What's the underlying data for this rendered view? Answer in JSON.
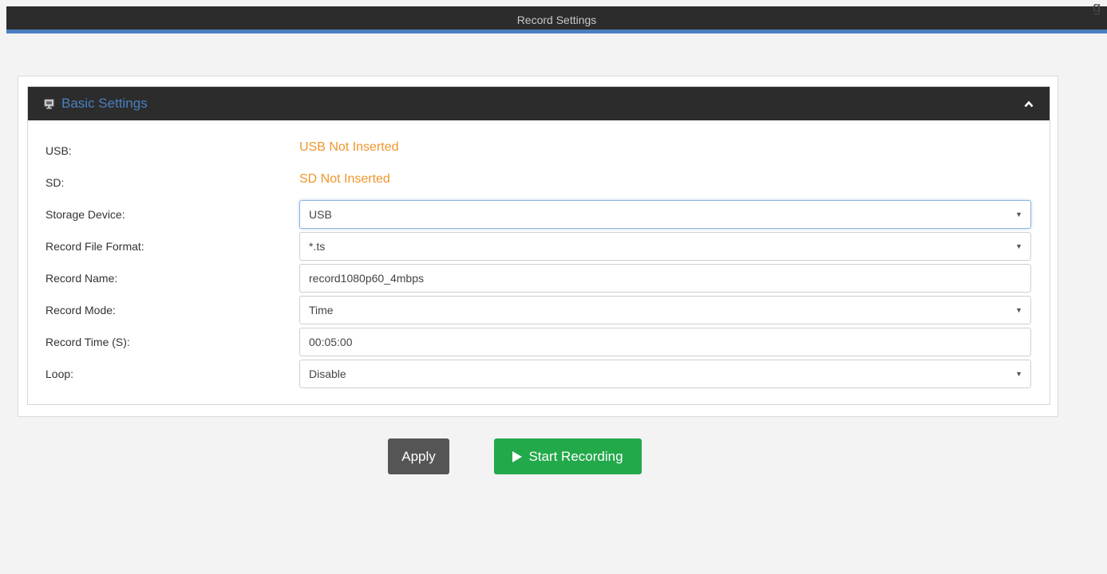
{
  "header": {
    "title": "Record Settings",
    "corner_glyph": "g"
  },
  "panel": {
    "title": "Basic Settings",
    "icon": "monitor-icon",
    "collapse_icon": "chevron-up-icon"
  },
  "status": {
    "usb": {
      "label": "USB:",
      "value": "USB Not Inserted"
    },
    "sd": {
      "label": "SD:",
      "value": "SD Not Inserted"
    }
  },
  "fields": {
    "storage_device": {
      "label": "Storage Device:",
      "value": "USB"
    },
    "record_file_format": {
      "label": "Record File Format:",
      "value": "*.ts"
    },
    "record_name": {
      "label": "Record Name:",
      "value": "record1080p60_4mbps"
    },
    "record_mode": {
      "label": "Record Mode:",
      "value": "Time"
    },
    "record_time": {
      "label": "Record Time (S):",
      "value": "00:05:00"
    },
    "loop": {
      "label": "Loop:",
      "value": "Disable"
    }
  },
  "buttons": {
    "apply": "Apply",
    "start_recording": "Start Recording"
  },
  "colors": {
    "accent": "#4a7fc1",
    "warning": "#f0962a",
    "start_green": "#22a94a",
    "header_dark": "#2c2c2c"
  }
}
